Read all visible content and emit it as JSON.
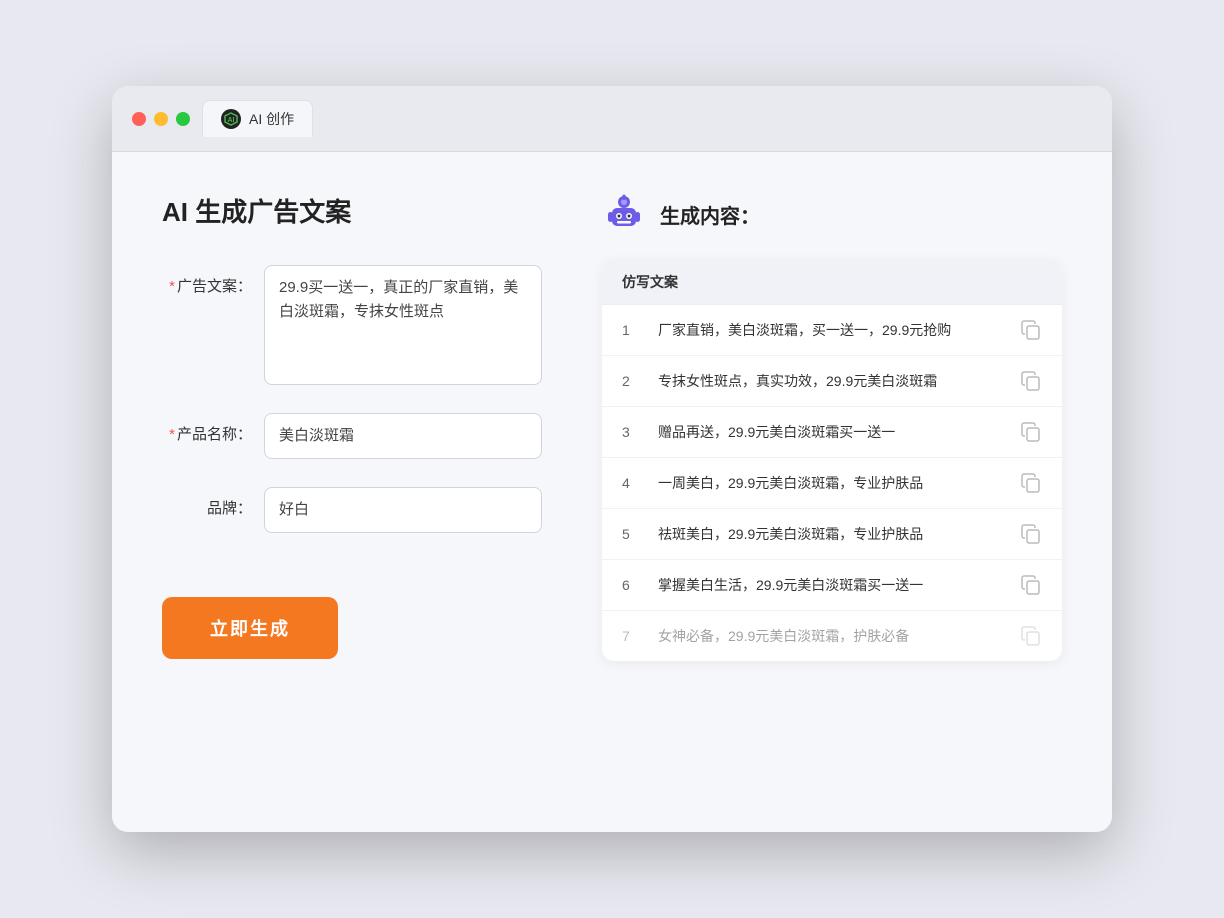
{
  "window": {
    "tab_label": "AI 创作",
    "traffic_lights": [
      "red",
      "yellow",
      "green"
    ]
  },
  "left_panel": {
    "title": "AI 生成广告文案",
    "form": {
      "ad_copy_label": "广告文案：",
      "ad_copy_required": true,
      "ad_copy_value": "29.9买一送一，真正的厂家直销，美白淡斑霜，专抹女性斑点",
      "product_name_label": "产品名称：",
      "product_name_required": true,
      "product_name_value": "美白淡斑霜",
      "brand_label": "品牌：",
      "brand_required": false,
      "brand_value": "好白"
    },
    "generate_button": "立即生成"
  },
  "right_panel": {
    "title": "生成内容：",
    "table_header": "仿写文案",
    "results": [
      {
        "num": "1",
        "text": "厂家直销，美白淡斑霜，买一送一，29.9元抢购",
        "dimmed": false
      },
      {
        "num": "2",
        "text": "专抹女性斑点，真实功效，29.9元美白淡斑霜",
        "dimmed": false
      },
      {
        "num": "3",
        "text": "赠品再送，29.9元美白淡斑霜买一送一",
        "dimmed": false
      },
      {
        "num": "4",
        "text": "一周美白，29.9元美白淡斑霜，专业护肤品",
        "dimmed": false
      },
      {
        "num": "5",
        "text": "祛斑美白，29.9元美白淡斑霜，专业护肤品",
        "dimmed": false
      },
      {
        "num": "6",
        "text": "掌握美白生活，29.9元美白淡斑霜买一送一",
        "dimmed": false
      },
      {
        "num": "7",
        "text": "女神必备，29.9元美白淡斑霜，护肤必备",
        "dimmed": true
      }
    ]
  }
}
